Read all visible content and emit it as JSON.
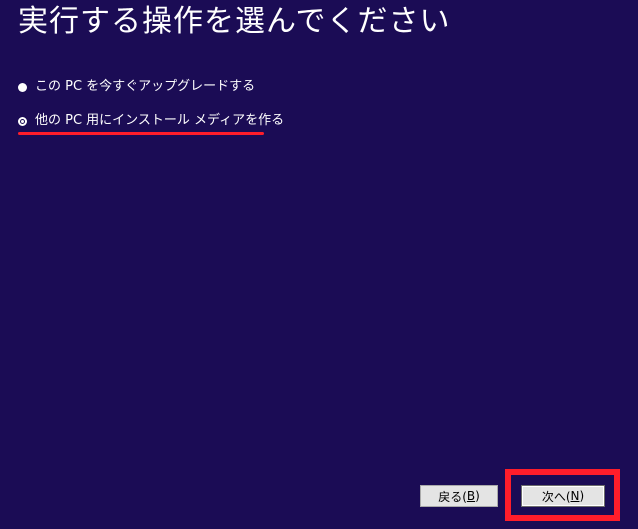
{
  "page": {
    "title": "実行する操作を選んでください"
  },
  "options": [
    {
      "label": "この PC を今すぐアップグレードする",
      "selected": false
    },
    {
      "label": "他の PC 用にインストール メディアを作る",
      "selected": true
    }
  ],
  "buttons": {
    "back": {
      "label": "戻る(",
      "accel": "B",
      "suffix": ")"
    },
    "next": {
      "label": "次へ(",
      "accel": "N",
      "suffix": ")"
    }
  },
  "colors": {
    "background": "#1b0c55",
    "highlight": "#ff1d2a",
    "button_face": "#e4e4e4"
  }
}
